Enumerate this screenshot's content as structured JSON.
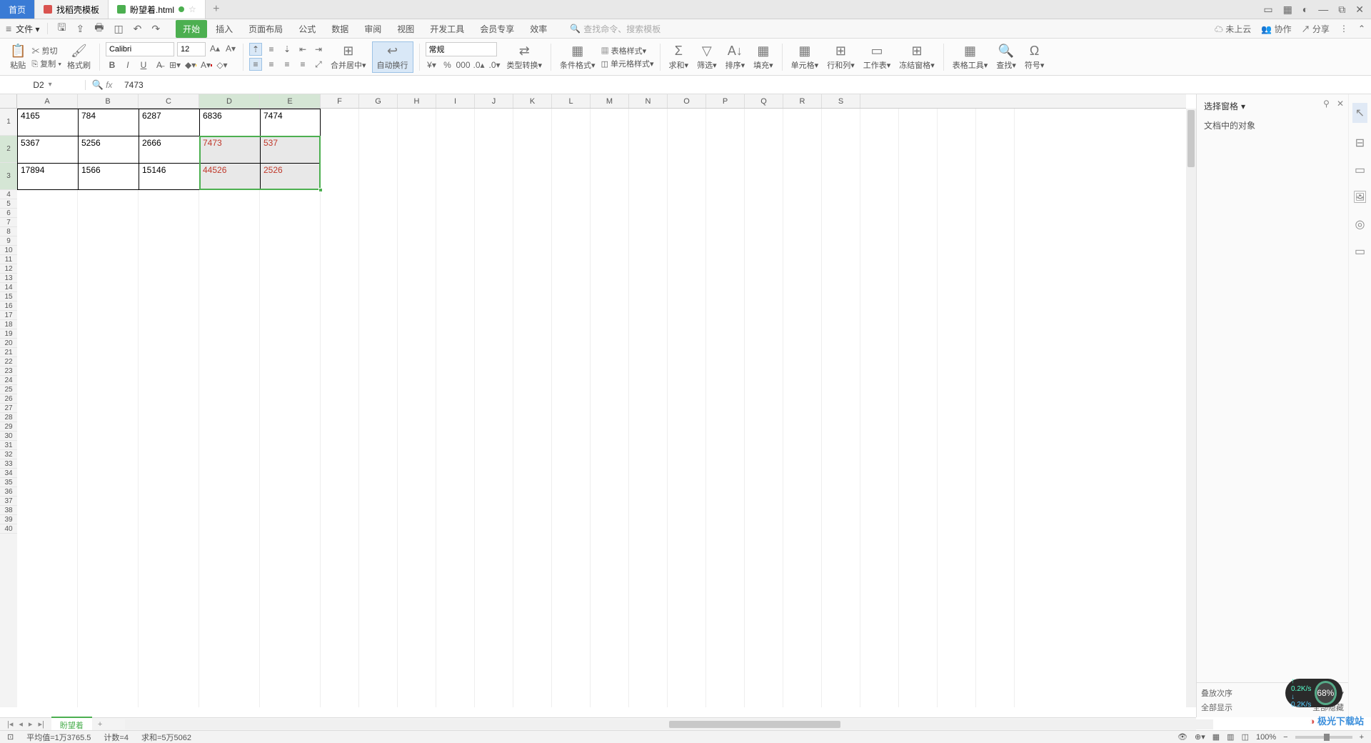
{
  "titlebar": {
    "home": "首页",
    "tab1": "找稻壳模板",
    "tab2": "盼望着.html",
    "newtab": "+"
  },
  "win": {
    "min": "—",
    "max": "☐",
    "close": "✕",
    "restore": "⧉"
  },
  "menubar": {
    "file": "文件",
    "tabs": [
      "开始",
      "插入",
      "页面布局",
      "公式",
      "数据",
      "审阅",
      "视图",
      "开发工具",
      "会员专享",
      "效率"
    ],
    "search_ph": "查找命令、搜索模板",
    "cloud": "未上云",
    "coop": "协作",
    "share": "分享"
  },
  "ribbon": {
    "paste": "粘贴",
    "cut": "剪切",
    "copy": "复制",
    "brush": "格式刷",
    "font": "Calibri",
    "size": "12",
    "merge": "合并居中",
    "wrap": "自动换行",
    "numfmt": "常规",
    "typeconv": "类型转换",
    "condfmt": "条件格式",
    "tablestyle": "表格样式",
    "cellstyle": "单元格样式",
    "sum": "求和",
    "filter": "筛选",
    "sort": "排序",
    "fill": "填充",
    "cells": "单元格",
    "rowcol": "行和列",
    "sheet": "工作表",
    "freeze": "冻结窗格",
    "tools": "表格工具",
    "find": "查找",
    "symbol": "符号"
  },
  "fbar": {
    "name": "D2",
    "fx": "fx",
    "value": "7473"
  },
  "columns": [
    "A",
    "B",
    "C",
    "D",
    "E",
    "F",
    "G",
    "H",
    "I",
    "J",
    "K",
    "L",
    "M",
    "N",
    "O",
    "P",
    "Q",
    "R",
    "S"
  ],
  "sel_cols": [
    "D",
    "E"
  ],
  "sel_rows": [
    2,
    3
  ],
  "rows_tall": 3,
  "rows_short": 37,
  "cells": [
    [
      "4165",
      "784",
      "6287",
      "6836",
      "7474"
    ],
    [
      "5367",
      "5256",
      "2666",
      "7473",
      "537"
    ],
    [
      "17894",
      "1566",
      "15146",
      "44526",
      "2526"
    ]
  ],
  "sheet": {
    "name": "盼望着"
  },
  "rpanel": {
    "title": "选择窗格",
    "subtitle": "文档中的对象",
    "order": "叠放次序",
    "showall": "全部显示",
    "hideall": "全部隐藏"
  },
  "status": {
    "avg": "平均值=1万3765.5",
    "count": "计数=4",
    "sum": "求和=5万5062",
    "zoom": "100%"
  },
  "badge": {
    "up": "0.2K/s",
    "down": "0.2K/s",
    "pct": "68%"
  },
  "watermark": "极光下载站"
}
